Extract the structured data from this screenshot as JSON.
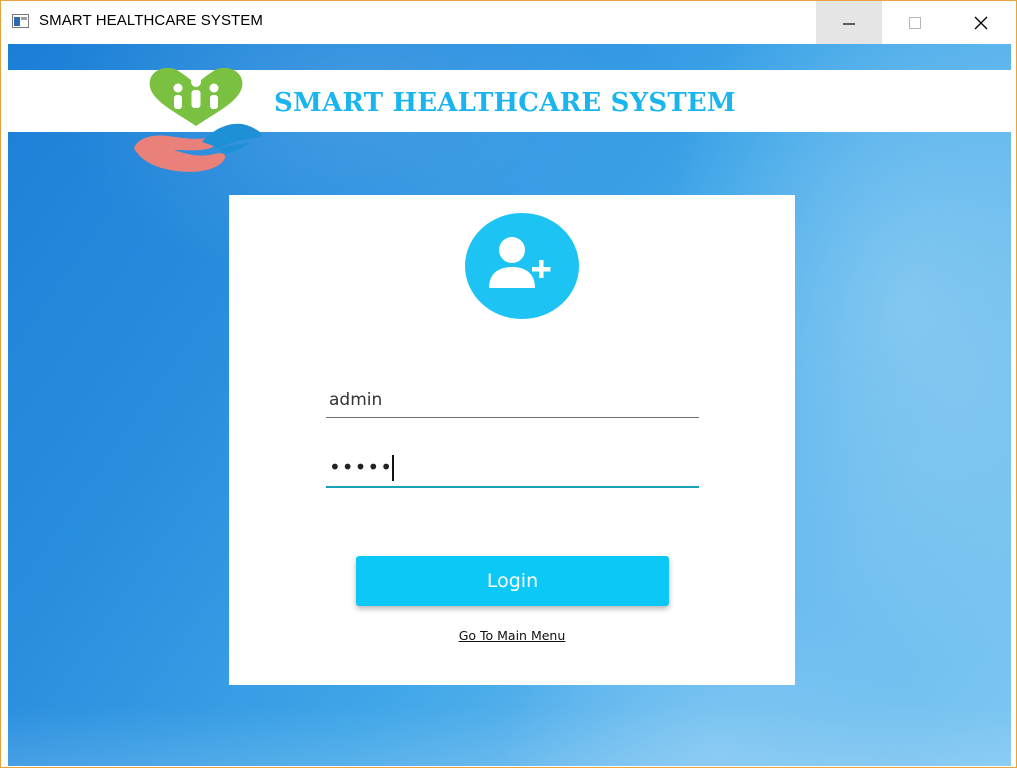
{
  "window": {
    "title": "SMART HEALTHCARE SYSTEM",
    "controls": [
      "minimize",
      "maximize",
      "close"
    ]
  },
  "header": {
    "brand_title": "SMART HEALTHCARE SYSTEM",
    "logo_icon": "heart-hands-family-logo"
  },
  "login_form": {
    "avatar_icon": "add-user-icon",
    "username_value": "admin",
    "password_masked": "•••••",
    "login_label": "Login",
    "main_menu_link": "Go To Main Menu"
  },
  "colors": {
    "accent": "#0cc8f6",
    "brand_text": "#1ab4ee",
    "focus_underline": "#17a2b8",
    "logo_green": "#7ac142",
    "logo_pink": "#e9807a",
    "logo_blue": "#1e90d6"
  }
}
